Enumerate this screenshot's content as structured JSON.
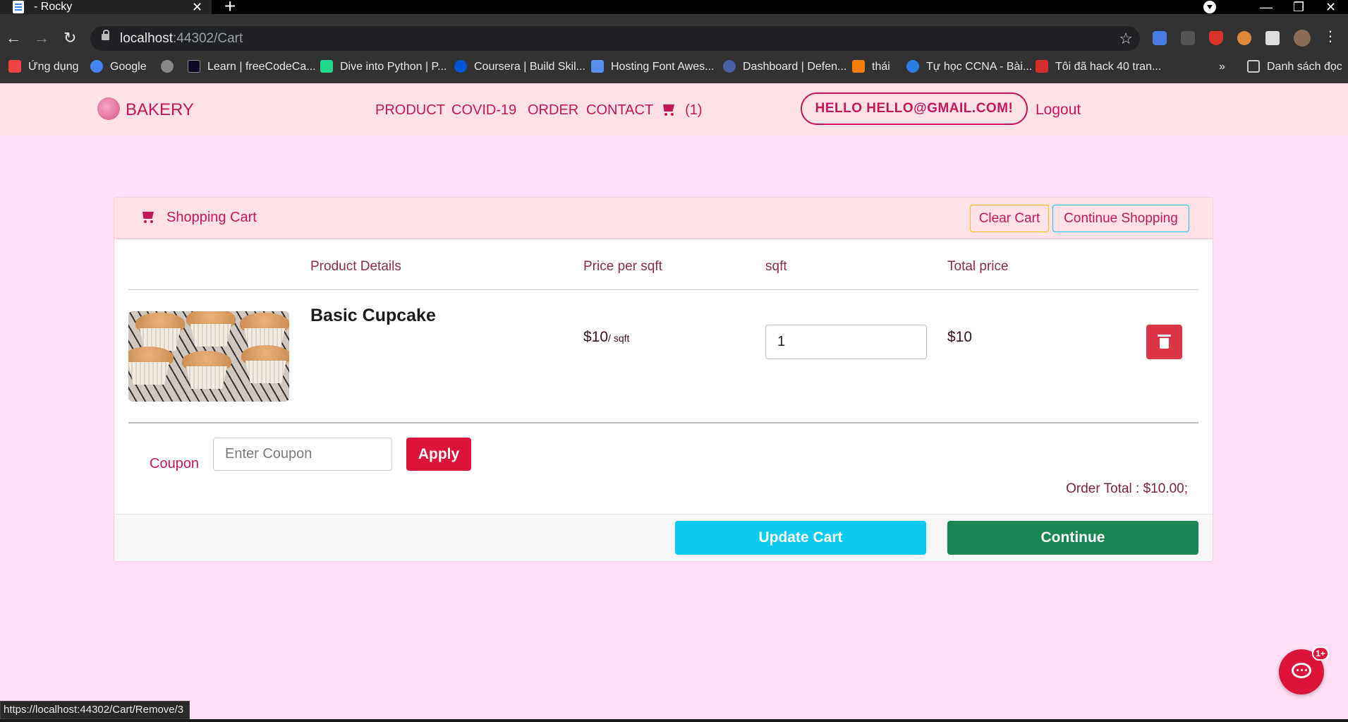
{
  "browser": {
    "tab_title": "- Rocky",
    "tab_close": "✕",
    "new_tab": "+",
    "url_host": "localhost",
    "url_rest": ":44302/Cart",
    "window_minimize": "—",
    "window_restore": "❐",
    "window_close": "✕",
    "bookmarks": [
      {
        "label": "Ứng dụng",
        "color": "#e44"
      },
      {
        "label": "Google",
        "color": "#4285f4"
      },
      {
        "label": "",
        "color": "#888"
      },
      {
        "label": "Learn | freeCodeCa...",
        "color": "#0a0a23"
      },
      {
        "label": "Dive into Python | P...",
        "color": "#21d789"
      },
      {
        "label": "Coursera | Build Skil...",
        "color": "#0056d2"
      },
      {
        "label": "Hosting Font Awes...",
        "color": "#5a8dee"
      },
      {
        "label": "Dashboard | Defen...",
        "color": "#4a5fa8"
      },
      {
        "label": "thái",
        "color": "#f57d00"
      },
      {
        "label": "Tự học CCNA - Bài...",
        "color": "#2a7de1"
      },
      {
        "label": "Tôi đã hack 40 tran...",
        "color": "#d32f2f"
      }
    ],
    "bookmarks_overflow": "»",
    "reading_list": "Danh sách đọc",
    "status_url": "https://localhost:44302/Cart/Remove/3"
  },
  "site": {
    "brand": "BAKERY",
    "nav": [
      "PRODUCT",
      "COVID-19",
      "ORDER",
      "CONTACT"
    ],
    "cart_count": "(1)",
    "hello": "HELLO HELLO@GMAIL.COM!",
    "logout": "Logout"
  },
  "cart": {
    "title": "Shopping Cart",
    "clear_label": "Clear Cart",
    "continue_shopping_label": "Continue Shopping",
    "columns": [
      "Product Details",
      "Price per sqft",
      "sqft",
      "Total price"
    ],
    "items": [
      {
        "name": "Basic Cupcake",
        "price": "$10",
        "price_unit": "/ sqft",
        "qty": "1",
        "total": "$10"
      }
    ],
    "coupon_label": "Coupon",
    "coupon_placeholder": "Enter Coupon",
    "apply_label": "Apply",
    "order_total": "Order Total : $10.00;",
    "update_label": "Update Cart",
    "continue_label": "Continue"
  },
  "chat": {
    "badge": "1+"
  },
  "colors": {
    "accent": "#c2185b",
    "page_bg": "#ffdff7",
    "nav_bg": "#ffe1e6",
    "danger": "#dc3545",
    "info": "#0dcaf0",
    "success": "#198754"
  }
}
